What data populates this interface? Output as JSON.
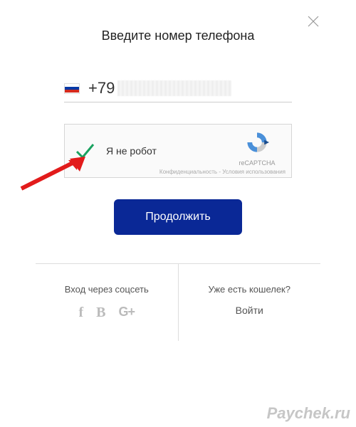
{
  "modal": {
    "title": "Введите номер телефона",
    "phone_prefix": "+79",
    "captcha_label": "Я не робот",
    "recaptcha_brand": "reCAPTCHA",
    "recaptcha_privacy": "Конфиденциальность",
    "recaptcha_terms": "Условия использования",
    "continue_label": "Продолжить"
  },
  "footer": {
    "social_title": "Вход через соцсеть",
    "social": {
      "fb": "f",
      "vk": "B",
      "google": "G+"
    },
    "wallet_title": "Уже есть кошелек?",
    "login_label": "Войти"
  },
  "watermark": "Paychek.ru"
}
